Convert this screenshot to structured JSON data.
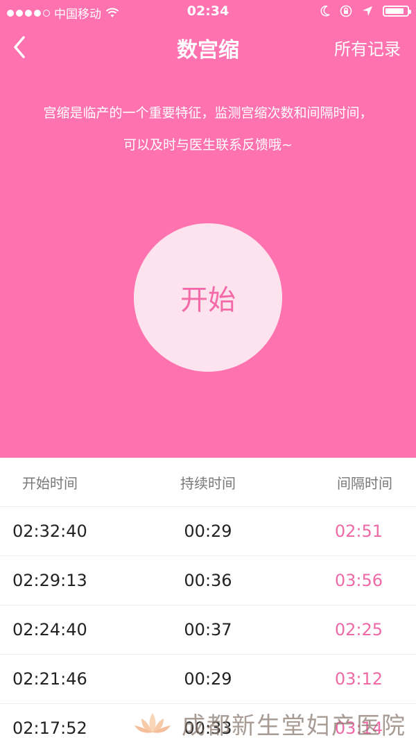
{
  "status_bar": {
    "carrier": "中国移动",
    "time": "02:34",
    "battery_level": 0.85
  },
  "nav": {
    "title": "数宫缩",
    "right_label": "所有记录"
  },
  "description": {
    "line1": "宫缩是临产的一个重要特征，监测宫缩次数和间隔时间，",
    "line2": "可以及时与医生联系反馈哦~"
  },
  "start_button": {
    "label": "开始"
  },
  "table": {
    "headers": [
      "开始时间",
      "持续时间",
      "间隔时间"
    ],
    "rows": [
      {
        "start": "02:32:40",
        "duration": "00:29",
        "interval": "02:51"
      },
      {
        "start": "02:29:13",
        "duration": "00:36",
        "interval": "03:56"
      },
      {
        "start": "02:24:40",
        "duration": "00:37",
        "interval": "02:25"
      },
      {
        "start": "02:21:46",
        "duration": "00:29",
        "interval": "03:12"
      },
      {
        "start": "02:17:52",
        "duration": "00:33",
        "interval": "03:14"
      }
    ]
  },
  "watermark": {
    "text": "成都新生堂妇产医院"
  },
  "colors": {
    "accent_pink": "#ff72b0",
    "interval_pink": "#ee6aa6",
    "button_bg": "#fde3ee"
  }
}
